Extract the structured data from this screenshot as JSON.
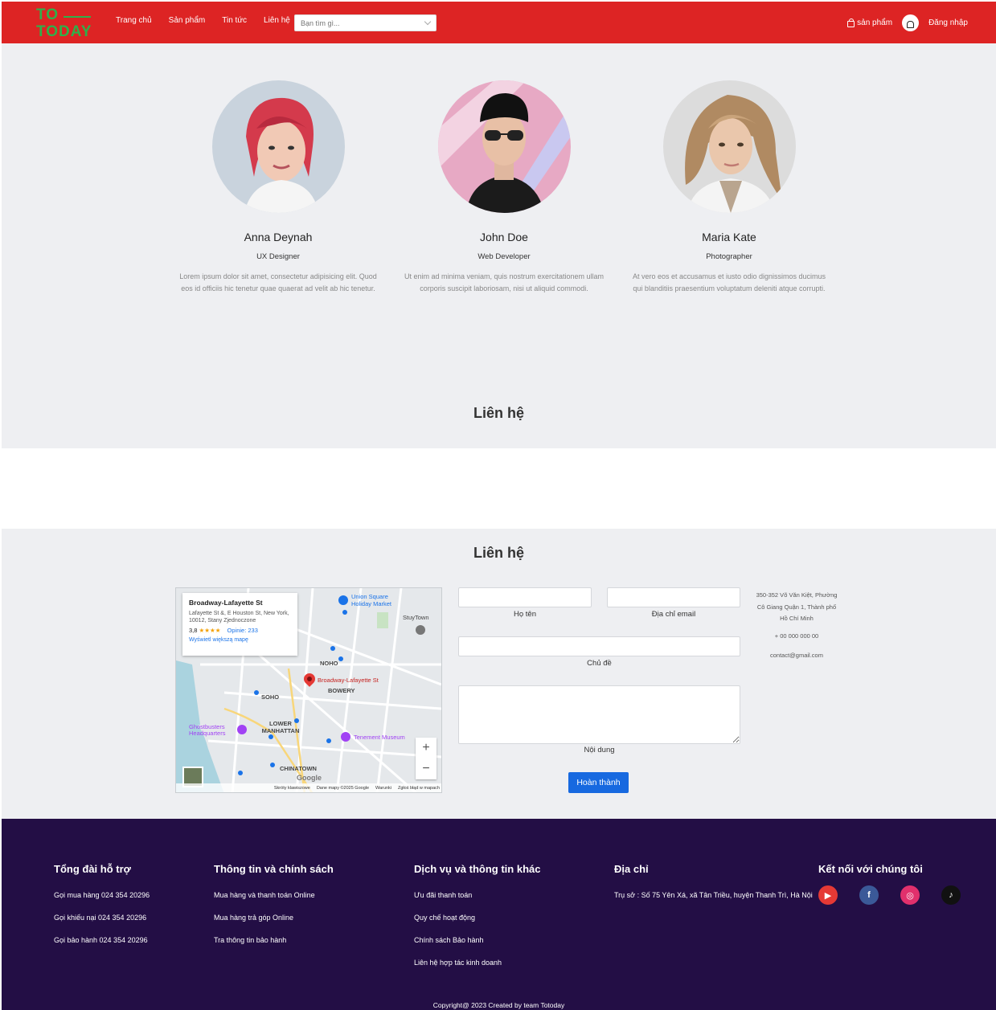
{
  "brand": {
    "line1": "TO",
    "line2": "TODAY"
  },
  "nav": {
    "items": [
      {
        "label": "Trang chủ"
      },
      {
        "label": "Sản phẩm"
      },
      {
        "label": "Tin tức"
      },
      {
        "label": "Liên hệ"
      }
    ],
    "search_placeholder": "Bạn tìm gì...",
    "cart_label": "sản phẩm",
    "login_label": "Đăng nhập"
  },
  "team": {
    "members": [
      {
        "name": "Anna Deynah",
        "role": "UX Designer",
        "bio": "Lorem ipsum dolor sit amet, consectetur adipisicing elit. Quod eos id officiis hic tenetur quae quaerat ad velit ab hic tenetur."
      },
      {
        "name": "John Doe",
        "role": "Web Developer",
        "bio": "Ut enim ad minima veniam, quis nostrum exercitationem ullam corporis suscipit laboriosam, nisi ut aliquid commodi."
      },
      {
        "name": "Maria Kate",
        "role": "Photographer",
        "bio": "At vero eos et accusamus et iusto odio dignissimos ducimus qui blanditiis praesentium voluptatum deleniti atque corrupti."
      }
    ],
    "section_title": "Liên hệ"
  },
  "contact": {
    "title": "Liên hệ",
    "map": {
      "place_title": "Broadway-Lafayette St",
      "address": "Lafayette St &, E Houston St, New York, 10012, Stany Zjednoczone",
      "rating": "3,8",
      "stars": "★★★★",
      "reviews": "Opinie: 233",
      "more_link": "Wyświetl większą mapę",
      "pin_label": "Broadway-Lafayette St",
      "labels": [
        "Union Square Holiday Market",
        "StuyTown",
        "NOHO",
        "BOWERY",
        "SOHO",
        "LOWER MANHATTAN",
        "CHINATOWN",
        "Tenement Museum",
        "Ghostbusters Headquarters"
      ],
      "footer": [
        "Skróty klawiszowe",
        "Dane mapy ©2025 Google",
        "Warunki",
        "Zgłoś błąd w mapach"
      ],
      "google": "Google"
    },
    "form": {
      "name_label": "Họ tên",
      "email_label": "Địa chỉ email",
      "subject_label": "Chủ đề",
      "message_label": "Nội dung",
      "submit_label": "Hoàn thành"
    },
    "info": {
      "address": "350-352 Võ Văn Kiệt, Phường Cô Giang Quận 1, Thành phố Hồ Chí Minh",
      "phone": "+ 00 000 000 00",
      "email": "contact@gmail.com"
    }
  },
  "footer": {
    "columns": [
      {
        "title": "Tổng đài hỗ trợ",
        "links": [
          "Gọi mua hàng 024 354 20296",
          "Gọi khiếu nại 024 354 20296",
          "Gọi bảo hành 024 354 20296"
        ]
      },
      {
        "title": "Thông tin và chính sách",
        "links": [
          "Mua hàng và thanh toán Online",
          "Mua hàng trả góp Online",
          "Tra thông tin bảo hành"
        ]
      },
      {
        "title": "Dịch vụ và thông tin khác",
        "links": [
          "Ưu đãi thanh toán",
          "Quy chế hoạt động",
          "Chính sách Bảo hành",
          "Liên hệ hợp tác kinh doanh"
        ]
      },
      {
        "title": "Địa chỉ",
        "links": [
          "Trụ sở : Số 75 Yên Xá, xã Tân Triều, huyện Thanh Trì, Hà Nội"
        ]
      },
      {
        "title": "Kết nối với chúng tôi",
        "links": []
      }
    ],
    "socials": [
      {
        "icon": "youtube-icon",
        "glyph": "▶",
        "color": "#e53935"
      },
      {
        "icon": "facebook-icon",
        "glyph": "f",
        "color": "#3b5998"
      },
      {
        "icon": "instagram-icon",
        "glyph": "◎",
        "color": "#e1306c"
      },
      {
        "icon": "tiktok-icon",
        "glyph": "♪",
        "color": "#111111"
      }
    ],
    "copyright": "Copyright@ 2023 Created by team Totoday"
  },
  "colors": {
    "nav": "#dd2424",
    "brand": "#2fb04a",
    "footer": "#230e45",
    "button": "#1769e0"
  }
}
